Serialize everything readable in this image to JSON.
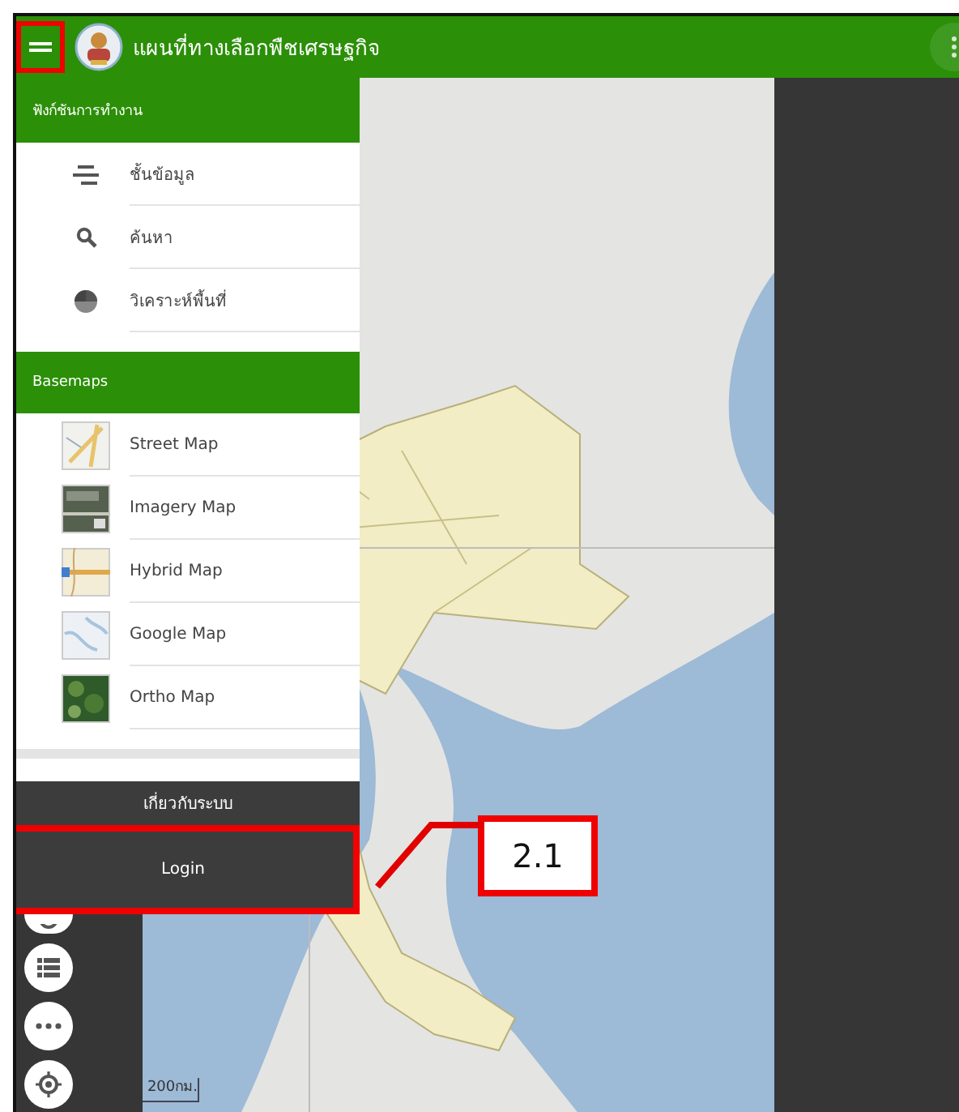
{
  "app_bar": {
    "title": "แผนที่ทางเลือกพืชเศรษฐกิจ",
    "menu_highlighted": true
  },
  "sidebar": {
    "sections": [
      {
        "title": "ฟังก์ชันการทำงาน",
        "items": [
          {
            "label": "ชั้นข้อมูล",
            "kind": "layers"
          },
          {
            "label": "ค้นหา",
            "kind": "search"
          },
          {
            "label": "วิเคราะห์พื้นที่",
            "kind": "analysis"
          }
        ]
      },
      {
        "title": "Basemaps",
        "items": [
          {
            "label": "Street Map",
            "kind": "street"
          },
          {
            "label": "Imagery Map",
            "kind": "imagery"
          },
          {
            "label": "Hybrid Map",
            "kind": "hybrid"
          },
          {
            "label": "Google Map",
            "kind": "google"
          },
          {
            "label": "Ortho Map",
            "kind": "ortho"
          }
        ]
      }
    ],
    "footer_items": [
      {
        "label": "เกี่ยวกับระบบ",
        "highlighted": false
      },
      {
        "label": "Login",
        "highlighted": true
      }
    ]
  },
  "map": {
    "scale": "200กม."
  },
  "callout": {
    "label": "2.1"
  }
}
